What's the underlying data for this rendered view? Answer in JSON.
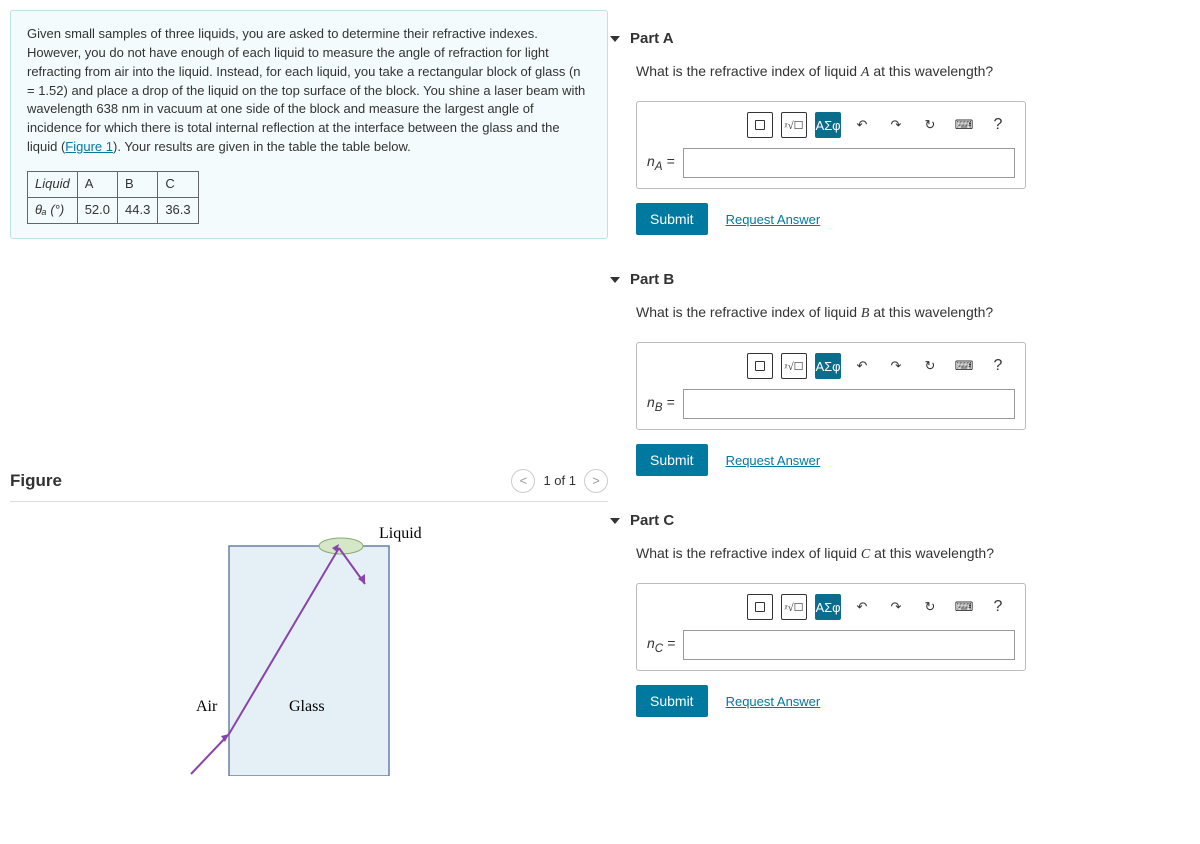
{
  "problem": {
    "text_before_link": "Given small samples of three liquids, you are asked to determine their refractive indexes. However, you do not have enough of each liquid to measure the angle of refraction for light refracting from air into the liquid. Instead, for each liquid, you take a rectangular block of glass (n = 1.52) and place a drop of the liquid on the top surface of the block. You shine a laser beam with wavelength 638 nm in vacuum at one side of the block and measure the largest angle of incidence for which there is total internal reflection at the interface between the glass and the liquid (",
    "link_text": "Figure 1",
    "text_after_link": "). Your results are given in the table the table below."
  },
  "table": {
    "r1": [
      "Liquid",
      "A",
      "B",
      "C"
    ],
    "r2_label": "θₐ (°)",
    "r2": [
      "52.0",
      "44.3",
      "36.3"
    ]
  },
  "figure": {
    "title": "Figure",
    "pager": "1 of 1",
    "labels": {
      "liquid": "Liquid",
      "air": "Air",
      "glass": "Glass"
    }
  },
  "parts": {
    "A": {
      "title": "Part A",
      "question_before": "What is the refractive index of liquid ",
      "liquid_letter": "A",
      "question_after": " at this wavelength?",
      "eq_label": "n_A =",
      "submit": "Submit",
      "request": "Request Answer"
    },
    "B": {
      "title": "Part B",
      "question_before": "What is the refractive index of liquid ",
      "liquid_letter": "B",
      "question_after": " at this wavelength?",
      "eq_label": "n_B =",
      "submit": "Submit",
      "request": "Request Answer"
    },
    "C": {
      "title": "Part C",
      "question_before": "What is the refractive index of liquid ",
      "liquid_letter": "C",
      "question_after": " at this wavelength?",
      "eq_label": "n_C =",
      "submit": "Submit",
      "request": "Request Answer"
    }
  },
  "toolbar": {
    "templates_icon": "■",
    "math_root": "ᵪ√☐",
    "greek": "ΑΣφ",
    "undo": "↶",
    "redo": "↷",
    "reset": "↻",
    "keyboard": "⌨",
    "help": "?"
  }
}
